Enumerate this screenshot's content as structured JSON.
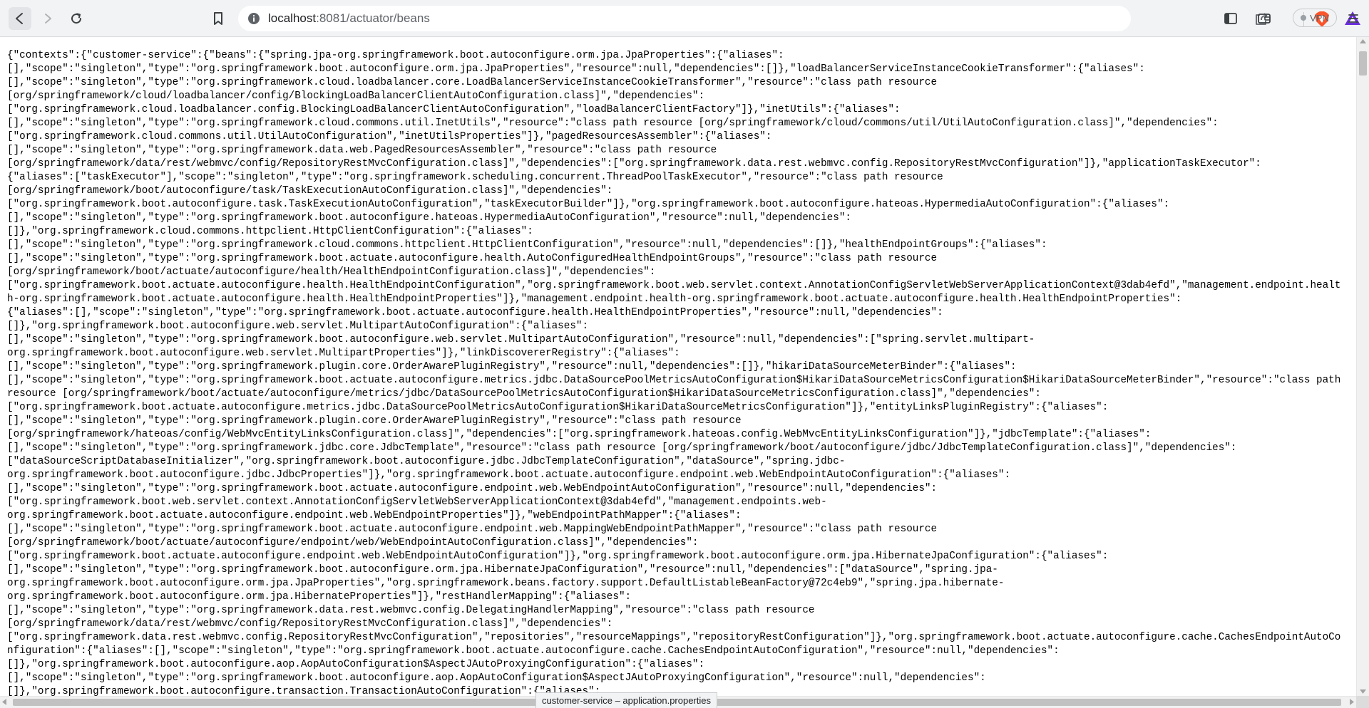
{
  "browser": {
    "url_host": "localhost",
    "url_rest": ":8081/actuator/beans",
    "vpn_label": "VPN",
    "status_bubble": "customer-service – application.properties",
    "icons": {
      "back": "back-arrow-icon",
      "forward": "forward-arrow-icon",
      "reload": "reload-icon",
      "bookmark": "bookmark-icon",
      "site_info": "info-icon",
      "share": "share-icon",
      "brave": "brave-shields-icon",
      "rewards": "brave-rewards-icon",
      "sidebar": "sidebar-icon",
      "wallet": "wallet-icon",
      "menu": "menu-icon"
    },
    "colors": {
      "brave_orange": "#fb542b",
      "rewards_purple": "#6b2ddb",
      "toolbar_bg": "#f1f3f4"
    }
  },
  "page": {
    "json_text": "{\"contexts\":{\"customer-service\":{\"beans\":{\"spring.jpa-org.springframework.boot.autoconfigure.orm.jpa.JpaProperties\":{\"aliases\":\n[],\"scope\":\"singleton\",\"type\":\"org.springframework.boot.autoconfigure.orm.jpa.JpaProperties\",\"resource\":null,\"dependencies\":[]},\"loadBalancerServiceInstanceCookieTransformer\":{\"aliases\":\n[],\"scope\":\"singleton\",\"type\":\"org.springframework.cloud.loadbalancer.core.LoadBalancerServiceInstanceCookieTransformer\",\"resource\":\"class path resource\n[org/springframework/cloud/loadbalancer/config/BlockingLoadBalancerClientAutoConfiguration.class]\",\"dependencies\":\n[\"org.springframework.cloud.loadbalancer.config.BlockingLoadBalancerClientAutoConfiguration\",\"loadBalancerClientFactory\"]},\"inetUtils\":{\"aliases\":\n[],\"scope\":\"singleton\",\"type\":\"org.springframework.cloud.commons.util.InetUtils\",\"resource\":\"class path resource [org/springframework/cloud/commons/util/UtilAutoConfiguration.class]\",\"dependencies\":\n[\"org.springframework.cloud.commons.util.UtilAutoConfiguration\",\"inetUtilsProperties\"]},\"pagedResourcesAssembler\":{\"aliases\":\n[],\"scope\":\"singleton\",\"type\":\"org.springframework.data.web.PagedResourcesAssembler\",\"resource\":\"class path resource\n[org/springframework/data/rest/webmvc/config/RepositoryRestMvcConfiguration.class]\",\"dependencies\":[\"org.springframework.data.rest.webmvc.config.RepositoryRestMvcConfiguration\"]},\"applicationTaskExecutor\":\n{\"aliases\":[\"taskExecutor\"],\"scope\":\"singleton\",\"type\":\"org.springframework.scheduling.concurrent.ThreadPoolTaskExecutor\",\"resource\":\"class path resource\n[org/springframework/boot/autoconfigure/task/TaskExecutionAutoConfiguration.class]\",\"dependencies\":\n[\"org.springframework.boot.autoconfigure.task.TaskExecutionAutoConfiguration\",\"taskExecutorBuilder\"]},\"org.springframework.boot.autoconfigure.hateoas.HypermediaAutoConfiguration\":{\"aliases\":\n[],\"scope\":\"singleton\",\"type\":\"org.springframework.boot.autoconfigure.hateoas.HypermediaAutoConfiguration\",\"resource\":null,\"dependencies\":\n[]},\"org.springframework.cloud.commons.httpclient.HttpClientConfiguration\":{\"aliases\":\n[],\"scope\":\"singleton\",\"type\":\"org.springframework.cloud.commons.httpclient.HttpClientConfiguration\",\"resource\":null,\"dependencies\":[]},\"healthEndpointGroups\":{\"aliases\":\n[],\"scope\":\"singleton\",\"type\":\"org.springframework.boot.actuate.autoconfigure.health.AutoConfiguredHealthEndpointGroups\",\"resource\":\"class path resource\n[org/springframework/boot/actuate/autoconfigure/health/HealthEndpointConfiguration.class]\",\"dependencies\":\n[\"org.springframework.boot.actuate.autoconfigure.health.HealthEndpointConfiguration\",\"org.springframework.boot.web.servlet.context.AnnotationConfigServletWebServerApplicationContext@3dab4efd\",\"management.endpoint.health-org.springframework.boot.actuate.autoconfigure.health.HealthEndpointProperties\"]},\"management.endpoint.health-org.springframework.boot.actuate.autoconfigure.health.HealthEndpointProperties\":\n{\"aliases\":[],\"scope\":\"singleton\",\"type\":\"org.springframework.boot.actuate.autoconfigure.health.HealthEndpointProperties\",\"resource\":null,\"dependencies\":\n[]},\"org.springframework.boot.autoconfigure.web.servlet.MultipartAutoConfiguration\":{\"aliases\":\n[],\"scope\":\"singleton\",\"type\":\"org.springframework.boot.autoconfigure.web.servlet.MultipartAutoConfiguration\",\"resource\":null,\"dependencies\":[\"spring.servlet.multipart-\norg.springframework.boot.autoconfigure.web.servlet.MultipartProperties\"]},\"linkDiscovererRegistry\":{\"aliases\":\n[],\"scope\":\"singleton\",\"type\":\"org.springframework.plugin.core.OrderAwarePluginRegistry\",\"resource\":null,\"dependencies\":[]},\"hikariDataSourceMeterBinder\":{\"aliases\":\n[],\"scope\":\"singleton\",\"type\":\"org.springframework.boot.actuate.autoconfigure.metrics.jdbc.DataSourcePoolMetricsAutoConfiguration$HikariDataSourceMetricsConfiguration$HikariDataSourceMeterBinder\",\"resource\":\"class path resource [org/springframework/boot/actuate/autoconfigure/metrics/jdbc/DataSourcePoolMetricsAutoConfiguration$HikariDataSourceMetricsConfiguration.class]\",\"dependencies\":\n[\"org.springframework.boot.actuate.autoconfigure.metrics.jdbc.DataSourcePoolMetricsAutoConfiguration$HikariDataSourceMetricsConfiguration\"]},\"entityLinksPluginRegistry\":{\"aliases\":\n[],\"scope\":\"singleton\",\"type\":\"org.springframework.plugin.core.OrderAwarePluginRegistry\",\"resource\":\"class path resource\n[org/springframework/hateoas/config/WebMvcEntityLinksConfiguration.class]\",\"dependencies\":[\"org.springframework.hateoas.config.WebMvcEntityLinksConfiguration\"]},\"jdbcTemplate\":{\"aliases\":\n[],\"scope\":\"singleton\",\"type\":\"org.springframework.jdbc.core.JdbcTemplate\",\"resource\":\"class path resource [org/springframework/boot/autoconfigure/jdbc/JdbcTemplateConfiguration.class]\",\"dependencies\":\n[\"dataSourceScriptDatabaseInitializer\",\"org.springframework.boot.autoconfigure.jdbc.JdbcTemplateConfiguration\",\"dataSource\",\"spring.jdbc-\norg.springframework.boot.autoconfigure.jdbc.JdbcProperties\"]},\"org.springframework.boot.actuate.autoconfigure.endpoint.web.WebEndpointAutoConfiguration\":{\"aliases\":\n[],\"scope\":\"singleton\",\"type\":\"org.springframework.boot.actuate.autoconfigure.endpoint.web.WebEndpointAutoConfiguration\",\"resource\":null,\"dependencies\":\n[\"org.springframework.boot.web.servlet.context.AnnotationConfigServletWebServerApplicationContext@3dab4efd\",\"management.endpoints.web-\norg.springframework.boot.actuate.autoconfigure.endpoint.web.WebEndpointProperties\"]},\"webEndpointPathMapper\":{\"aliases\":\n[],\"scope\":\"singleton\",\"type\":\"org.springframework.boot.actuate.autoconfigure.endpoint.web.MappingWebEndpointPathMapper\",\"resource\":\"class path resource\n[org/springframework/boot/actuate/autoconfigure/endpoint/web/WebEndpointAutoConfiguration.class]\",\"dependencies\":\n[\"org.springframework.boot.actuate.autoconfigure.endpoint.web.WebEndpointAutoConfiguration\"]},\"org.springframework.boot.autoconfigure.orm.jpa.HibernateJpaConfiguration\":{\"aliases\":\n[],\"scope\":\"singleton\",\"type\":\"org.springframework.boot.autoconfigure.orm.jpa.HibernateJpaConfiguration\",\"resource\":null,\"dependencies\":[\"dataSource\",\"spring.jpa-\norg.springframework.boot.autoconfigure.orm.jpa.JpaProperties\",\"org.springframework.beans.factory.support.DefaultListableBeanFactory@72c4eb9\",\"spring.jpa.hibernate-\norg.springframework.boot.autoconfigure.orm.jpa.HibernateProperties\"]},\"restHandlerMapping\":{\"aliases\":\n[],\"scope\":\"singleton\",\"type\":\"org.springframework.data.rest.webmvc.config.DelegatingHandlerMapping\",\"resource\":\"class path resource\n[org/springframework/data/rest/webmvc/config/RepositoryRestMvcConfiguration.class]\",\"dependencies\":\n[\"org.springframework.data.rest.webmvc.config.RepositoryRestMvcConfiguration\",\"repositories\",\"resourceMappings\",\"repositoryRestConfiguration\"]},\"org.springframework.boot.actuate.autoconfigure.cache.CachesEndpointAutoConfiguration\":{\"aliases\":[],\"scope\":\"singleton\",\"type\":\"org.springframework.boot.actuate.autoconfigure.cache.CachesEndpointAutoConfiguration\",\"resource\":null,\"dependencies\":\n[]},\"org.springframework.boot.autoconfigure.aop.AopAutoConfiguration$AspectJAutoProxyingConfiguration\":{\"aliases\":\n[],\"scope\":\"singleton\",\"type\":\"org.springframework.boot.autoconfigure.aop.AopAutoConfiguration$AspectJAutoProxyingConfiguration\",\"resource\":null,\"dependencies\":\n[]},\"org.springframework.boot.autoconfigure.transaction.TransactionAutoConfiguration\":{\"aliases\":"
  }
}
